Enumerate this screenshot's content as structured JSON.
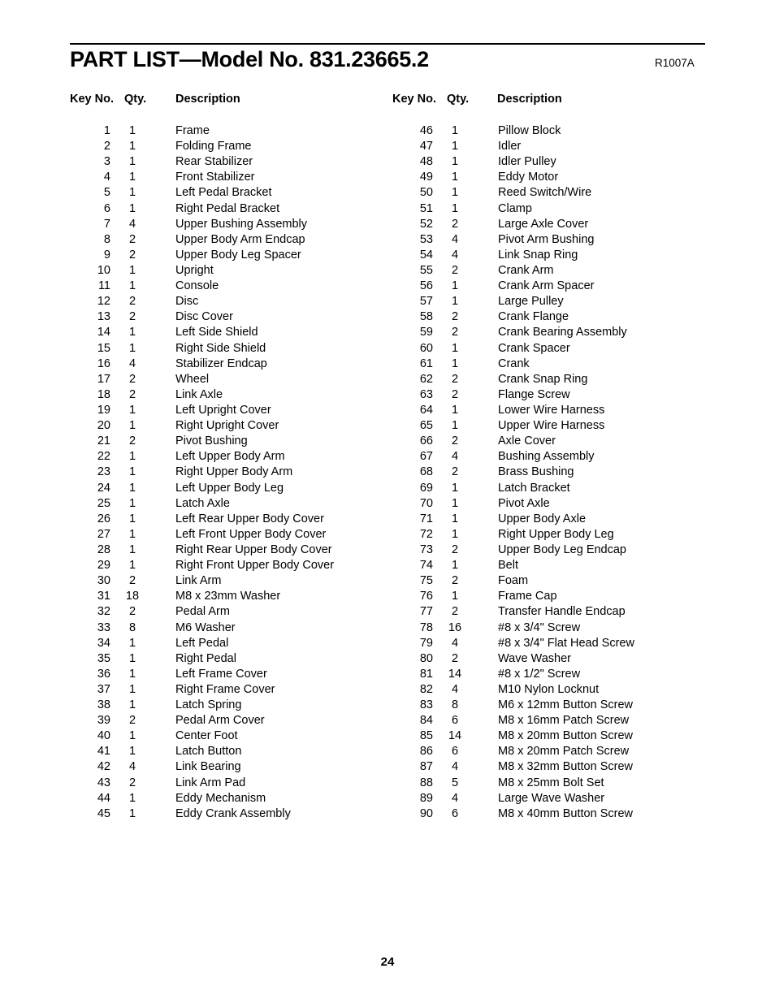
{
  "document": {
    "title": "PART LIST—Model No. 831.23665.2",
    "revision": "R1007A",
    "page_number": "24"
  },
  "columns": {
    "key_no": "Key No.",
    "qty": "Qty.",
    "description": "Description"
  },
  "left_column": [
    {
      "key": "1",
      "qty": "1",
      "desc": "Frame"
    },
    {
      "key": "2",
      "qty": "1",
      "desc": "Folding Frame"
    },
    {
      "key": "3",
      "qty": "1",
      "desc": "Rear Stabilizer"
    },
    {
      "key": "4",
      "qty": "1",
      "desc": "Front Stabilizer"
    },
    {
      "key": "5",
      "qty": "1",
      "desc": "Left Pedal Bracket"
    },
    {
      "key": "6",
      "qty": "1",
      "desc": "Right Pedal Bracket"
    },
    {
      "key": "7",
      "qty": "4",
      "desc": "Upper Bushing Assembly"
    },
    {
      "key": "8",
      "qty": "2",
      "desc": "Upper Body Arm Endcap"
    },
    {
      "key": "9",
      "qty": "2",
      "desc": "Upper Body Leg Spacer"
    },
    {
      "key": "10",
      "qty": "1",
      "desc": "Upright"
    },
    {
      "key": "11",
      "qty": "1",
      "desc": "Console"
    },
    {
      "key": "12",
      "qty": "2",
      "desc": "Disc"
    },
    {
      "key": "13",
      "qty": "2",
      "desc": "Disc Cover"
    },
    {
      "key": "14",
      "qty": "1",
      "desc": "Left Side Shield"
    },
    {
      "key": "15",
      "qty": "1",
      "desc": "Right Side Shield"
    },
    {
      "key": "16",
      "qty": "4",
      "desc": "Stabilizer Endcap"
    },
    {
      "key": "17",
      "qty": "2",
      "desc": "Wheel"
    },
    {
      "key": "18",
      "qty": "2",
      "desc": "Link Axle"
    },
    {
      "key": "19",
      "qty": "1",
      "desc": "Left Upright Cover"
    },
    {
      "key": "20",
      "qty": "1",
      "desc": "Right Upright Cover"
    },
    {
      "key": "21",
      "qty": "2",
      "desc": "Pivot Bushing"
    },
    {
      "key": "22",
      "qty": "1",
      "desc": "Left Upper Body Arm"
    },
    {
      "key": "23",
      "qty": "1",
      "desc": "Right Upper Body Arm"
    },
    {
      "key": "24",
      "qty": "1",
      "desc": "Left Upper Body Leg"
    },
    {
      "key": "25",
      "qty": "1",
      "desc": "Latch Axle"
    },
    {
      "key": "26",
      "qty": "1",
      "desc": "Left Rear Upper Body Cover"
    },
    {
      "key": "27",
      "qty": "1",
      "desc": "Left Front Upper Body Cover"
    },
    {
      "key": "28",
      "qty": "1",
      "desc": "Right Rear Upper Body Cover"
    },
    {
      "key": "29",
      "qty": "1",
      "desc": "Right Front Upper Body Cover"
    },
    {
      "key": "30",
      "qty": "2",
      "desc": "Link Arm"
    },
    {
      "key": "31",
      "qty": "18",
      "desc": "M8 x 23mm Washer"
    },
    {
      "key": "32",
      "qty": "2",
      "desc": "Pedal Arm"
    },
    {
      "key": "33",
      "qty": "8",
      "desc": "M6 Washer"
    },
    {
      "key": "34",
      "qty": "1",
      "desc": "Left Pedal"
    },
    {
      "key": "35",
      "qty": "1",
      "desc": "Right Pedal"
    },
    {
      "key": "36",
      "qty": "1",
      "desc": "Left Frame Cover"
    },
    {
      "key": "37",
      "qty": "1",
      "desc": "Right Frame Cover"
    },
    {
      "key": "38",
      "qty": "1",
      "desc": "Latch Spring"
    },
    {
      "key": "39",
      "qty": "2",
      "desc": "Pedal Arm Cover"
    },
    {
      "key": "40",
      "qty": "1",
      "desc": "Center Foot"
    },
    {
      "key": "41",
      "qty": "1",
      "desc": "Latch Button"
    },
    {
      "key": "42",
      "qty": "4",
      "desc": "Link Bearing"
    },
    {
      "key": "43",
      "qty": "2",
      "desc": "Link Arm Pad"
    },
    {
      "key": "44",
      "qty": "1",
      "desc": "Eddy Mechanism"
    },
    {
      "key": "45",
      "qty": "1",
      "desc": "Eddy Crank Assembly"
    }
  ],
  "right_column": [
    {
      "key": "46",
      "qty": "1",
      "desc": "Pillow Block"
    },
    {
      "key": "47",
      "qty": "1",
      "desc": "Idler"
    },
    {
      "key": "48",
      "qty": "1",
      "desc": "Idler Pulley"
    },
    {
      "key": "49",
      "qty": "1",
      "desc": "Eddy Motor"
    },
    {
      "key": "50",
      "qty": "1",
      "desc": "Reed Switch/Wire"
    },
    {
      "key": "51",
      "qty": "1",
      "desc": "Clamp"
    },
    {
      "key": "52",
      "qty": "2",
      "desc": "Large Axle Cover"
    },
    {
      "key": "53",
      "qty": "4",
      "desc": "Pivot Arm Bushing"
    },
    {
      "key": "54",
      "qty": "4",
      "desc": "Link Snap Ring"
    },
    {
      "key": "55",
      "qty": "2",
      "desc": "Crank Arm"
    },
    {
      "key": "56",
      "qty": "1",
      "desc": "Crank Arm Spacer"
    },
    {
      "key": "57",
      "qty": "1",
      "desc": "Large Pulley"
    },
    {
      "key": "58",
      "qty": "2",
      "desc": "Crank Flange"
    },
    {
      "key": "59",
      "qty": "2",
      "desc": "Crank Bearing Assembly"
    },
    {
      "key": "60",
      "qty": "1",
      "desc": "Crank Spacer"
    },
    {
      "key": "61",
      "qty": "1",
      "desc": "Crank"
    },
    {
      "key": "62",
      "qty": "2",
      "desc": "Crank Snap Ring"
    },
    {
      "key": "63",
      "qty": "2",
      "desc": "Flange Screw"
    },
    {
      "key": "64",
      "qty": "1",
      "desc": "Lower Wire Harness"
    },
    {
      "key": "65",
      "qty": "1",
      "desc": "Upper Wire Harness"
    },
    {
      "key": "66",
      "qty": "2",
      "desc": "Axle Cover"
    },
    {
      "key": "67",
      "qty": "4",
      "desc": "Bushing Assembly"
    },
    {
      "key": "68",
      "qty": "2",
      "desc": "Brass Bushing"
    },
    {
      "key": "69",
      "qty": "1",
      "desc": "Latch Bracket"
    },
    {
      "key": "70",
      "qty": "1",
      "desc": "Pivot Axle"
    },
    {
      "key": "71",
      "qty": "1",
      "desc": "Upper Body Axle"
    },
    {
      "key": "72",
      "qty": "1",
      "desc": "Right Upper Body Leg"
    },
    {
      "key": "73",
      "qty": "2",
      "desc": "Upper Body Leg Endcap"
    },
    {
      "key": "74",
      "qty": "1",
      "desc": "Belt"
    },
    {
      "key": "75",
      "qty": "2",
      "desc": "Foam"
    },
    {
      "key": "76",
      "qty": "1",
      "desc": "Frame Cap"
    },
    {
      "key": "77",
      "qty": "2",
      "desc": "Transfer Handle Endcap"
    },
    {
      "key": "78",
      "qty": "16",
      "desc": "#8 x 3/4\" Screw"
    },
    {
      "key": "79",
      "qty": "4",
      "desc": "#8 x 3/4\" Flat Head Screw"
    },
    {
      "key": "80",
      "qty": "2",
      "desc": "Wave Washer"
    },
    {
      "key": "81",
      "qty": "14",
      "desc": "#8 x 1/2\" Screw"
    },
    {
      "key": "82",
      "qty": "4",
      "desc": "M10 Nylon Locknut"
    },
    {
      "key": "83",
      "qty": "8",
      "desc": "M6 x 12mm Button Screw"
    },
    {
      "key": "84",
      "qty": "6",
      "desc": "M8 x 16mm Patch Screw"
    },
    {
      "key": "85",
      "qty": "14",
      "desc": "M8 x 20mm Button Screw"
    },
    {
      "key": "86",
      "qty": "6",
      "desc": "M8 x 20mm Patch Screw"
    },
    {
      "key": "87",
      "qty": "4",
      "desc": "M8 x 32mm Button Screw"
    },
    {
      "key": "88",
      "qty": "5",
      "desc": "M8 x 25mm Bolt Set"
    },
    {
      "key": "89",
      "qty": "4",
      "desc": "Large Wave Washer"
    },
    {
      "key": "90",
      "qty": "6",
      "desc": "M8 x 40mm Button Screw"
    }
  ]
}
